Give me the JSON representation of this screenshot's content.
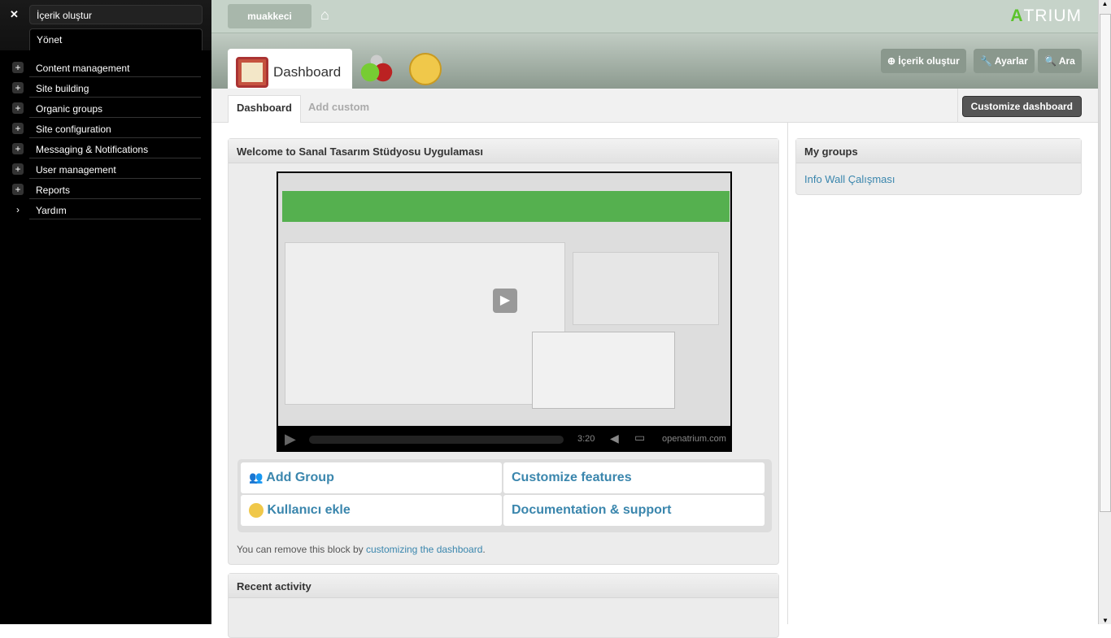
{
  "sidebar": {
    "create": "İçerik oluştur",
    "tab": "Yönet",
    "items": [
      {
        "label": "Content management",
        "icon": "plus"
      },
      {
        "label": "Site building",
        "icon": "plus"
      },
      {
        "label": "Organic groups",
        "icon": "plus"
      },
      {
        "label": "Site configuration",
        "icon": "plus"
      },
      {
        "label": "Messaging & Notifications",
        "icon": "plus"
      },
      {
        "label": "User management",
        "icon": "plus"
      },
      {
        "label": "Reports",
        "icon": "plus"
      },
      {
        "label": "Yardım",
        "icon": "chevron-right"
      }
    ]
  },
  "header": {
    "user": "muakkeci",
    "logo": "TRIUM",
    "logo_accent": "A",
    "accent": "#5bc32b"
  },
  "space": {
    "tab": "Dashboard",
    "actions": {
      "create": "İçerik oluştur",
      "settings": "Ayarlar",
      "search": "Ara"
    }
  },
  "subtabs": {
    "active": "Dashboard",
    "other": "Add custom",
    "customize": "Customize dashboard"
  },
  "welcome": {
    "title": "Welcome to Sanal Tasarım Stüdyosu Uygulaması",
    "video": {
      "time": "3:20",
      "brand": "openatrium.com"
    },
    "links": [
      "Add Group",
      "Customize features",
      "Kullanıcı ekle",
      "Documentation & support"
    ],
    "note_pre": "You can remove this block by ",
    "note_link": "customizing the dashboard",
    "note_post": "."
  },
  "recent": {
    "title": "Recent activity"
  },
  "groups": {
    "title": "My groups",
    "item": "Info Wall Çalışması"
  }
}
